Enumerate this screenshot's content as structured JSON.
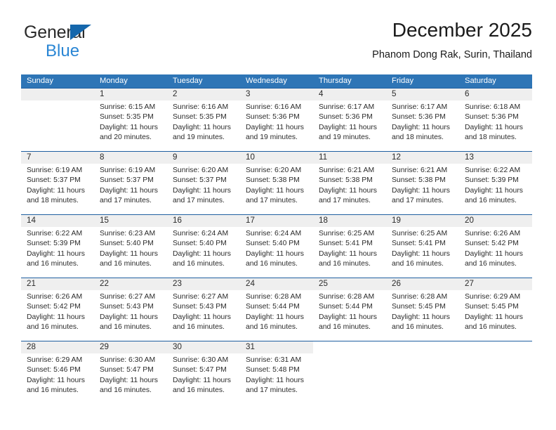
{
  "brand": {
    "name_primary": "General",
    "name_secondary": "Blue"
  },
  "header": {
    "title": "December 2025",
    "subtitle": "Phanom Dong Rak, Surin, Thailand"
  },
  "colors": {
    "header_blue": "#2e75b6",
    "row_divider": "#1f5fa0",
    "daynum_band": "#efefef",
    "logo_blue": "#2a86d4",
    "logo_triangle": "#1567ac"
  },
  "labels": {
    "sunrise_prefix": "Sunrise:",
    "sunset_prefix": "Sunset:",
    "daylight_prefix": "Daylight:"
  },
  "weekdays": [
    "Sunday",
    "Monday",
    "Tuesday",
    "Wednesday",
    "Thursday",
    "Friday",
    "Saturday"
  ],
  "weeks": [
    [
      {
        "day": "",
        "sunrise": "",
        "sunset": "",
        "daylight_line1": "",
        "daylight_line2": ""
      },
      {
        "day": "1",
        "sunrise": "Sunrise: 6:15 AM",
        "sunset": "Sunset: 5:35 PM",
        "daylight_line1": "Daylight: 11 hours",
        "daylight_line2": "and 20 minutes."
      },
      {
        "day": "2",
        "sunrise": "Sunrise: 6:16 AM",
        "sunset": "Sunset: 5:35 PM",
        "daylight_line1": "Daylight: 11 hours",
        "daylight_line2": "and 19 minutes."
      },
      {
        "day": "3",
        "sunrise": "Sunrise: 6:16 AM",
        "sunset": "Sunset: 5:36 PM",
        "daylight_line1": "Daylight: 11 hours",
        "daylight_line2": "and 19 minutes."
      },
      {
        "day": "4",
        "sunrise": "Sunrise: 6:17 AM",
        "sunset": "Sunset: 5:36 PM",
        "daylight_line1": "Daylight: 11 hours",
        "daylight_line2": "and 19 minutes."
      },
      {
        "day": "5",
        "sunrise": "Sunrise: 6:17 AM",
        "sunset": "Sunset: 5:36 PM",
        "daylight_line1": "Daylight: 11 hours",
        "daylight_line2": "and 18 minutes."
      },
      {
        "day": "6",
        "sunrise": "Sunrise: 6:18 AM",
        "sunset": "Sunset: 5:36 PM",
        "daylight_line1": "Daylight: 11 hours",
        "daylight_line2": "and 18 minutes."
      }
    ],
    [
      {
        "day": "7",
        "sunrise": "Sunrise: 6:19 AM",
        "sunset": "Sunset: 5:37 PM",
        "daylight_line1": "Daylight: 11 hours",
        "daylight_line2": "and 18 minutes."
      },
      {
        "day": "8",
        "sunrise": "Sunrise: 6:19 AM",
        "sunset": "Sunset: 5:37 PM",
        "daylight_line1": "Daylight: 11 hours",
        "daylight_line2": "and 17 minutes."
      },
      {
        "day": "9",
        "sunrise": "Sunrise: 6:20 AM",
        "sunset": "Sunset: 5:37 PM",
        "daylight_line1": "Daylight: 11 hours",
        "daylight_line2": "and 17 minutes."
      },
      {
        "day": "10",
        "sunrise": "Sunrise: 6:20 AM",
        "sunset": "Sunset: 5:38 PM",
        "daylight_line1": "Daylight: 11 hours",
        "daylight_line2": "and 17 minutes."
      },
      {
        "day": "11",
        "sunrise": "Sunrise: 6:21 AM",
        "sunset": "Sunset: 5:38 PM",
        "daylight_line1": "Daylight: 11 hours",
        "daylight_line2": "and 17 minutes."
      },
      {
        "day": "12",
        "sunrise": "Sunrise: 6:21 AM",
        "sunset": "Sunset: 5:38 PM",
        "daylight_line1": "Daylight: 11 hours",
        "daylight_line2": "and 17 minutes."
      },
      {
        "day": "13",
        "sunrise": "Sunrise: 6:22 AM",
        "sunset": "Sunset: 5:39 PM",
        "daylight_line1": "Daylight: 11 hours",
        "daylight_line2": "and 16 minutes."
      }
    ],
    [
      {
        "day": "14",
        "sunrise": "Sunrise: 6:22 AM",
        "sunset": "Sunset: 5:39 PM",
        "daylight_line1": "Daylight: 11 hours",
        "daylight_line2": "and 16 minutes."
      },
      {
        "day": "15",
        "sunrise": "Sunrise: 6:23 AM",
        "sunset": "Sunset: 5:40 PM",
        "daylight_line1": "Daylight: 11 hours",
        "daylight_line2": "and 16 minutes."
      },
      {
        "day": "16",
        "sunrise": "Sunrise: 6:24 AM",
        "sunset": "Sunset: 5:40 PM",
        "daylight_line1": "Daylight: 11 hours",
        "daylight_line2": "and 16 minutes."
      },
      {
        "day": "17",
        "sunrise": "Sunrise: 6:24 AM",
        "sunset": "Sunset: 5:40 PM",
        "daylight_line1": "Daylight: 11 hours",
        "daylight_line2": "and 16 minutes."
      },
      {
        "day": "18",
        "sunrise": "Sunrise: 6:25 AM",
        "sunset": "Sunset: 5:41 PM",
        "daylight_line1": "Daylight: 11 hours",
        "daylight_line2": "and 16 minutes."
      },
      {
        "day": "19",
        "sunrise": "Sunrise: 6:25 AM",
        "sunset": "Sunset: 5:41 PM",
        "daylight_line1": "Daylight: 11 hours",
        "daylight_line2": "and 16 minutes."
      },
      {
        "day": "20",
        "sunrise": "Sunrise: 6:26 AM",
        "sunset": "Sunset: 5:42 PM",
        "daylight_line1": "Daylight: 11 hours",
        "daylight_line2": "and 16 minutes."
      }
    ],
    [
      {
        "day": "21",
        "sunrise": "Sunrise: 6:26 AM",
        "sunset": "Sunset: 5:42 PM",
        "daylight_line1": "Daylight: 11 hours",
        "daylight_line2": "and 16 minutes."
      },
      {
        "day": "22",
        "sunrise": "Sunrise: 6:27 AM",
        "sunset": "Sunset: 5:43 PM",
        "daylight_line1": "Daylight: 11 hours",
        "daylight_line2": "and 16 minutes."
      },
      {
        "day": "23",
        "sunrise": "Sunrise: 6:27 AM",
        "sunset": "Sunset: 5:43 PM",
        "daylight_line1": "Daylight: 11 hours",
        "daylight_line2": "and 16 minutes."
      },
      {
        "day": "24",
        "sunrise": "Sunrise: 6:28 AM",
        "sunset": "Sunset: 5:44 PM",
        "daylight_line1": "Daylight: 11 hours",
        "daylight_line2": "and 16 minutes."
      },
      {
        "day": "25",
        "sunrise": "Sunrise: 6:28 AM",
        "sunset": "Sunset: 5:44 PM",
        "daylight_line1": "Daylight: 11 hours",
        "daylight_line2": "and 16 minutes."
      },
      {
        "day": "26",
        "sunrise": "Sunrise: 6:28 AM",
        "sunset": "Sunset: 5:45 PM",
        "daylight_line1": "Daylight: 11 hours",
        "daylight_line2": "and 16 minutes."
      },
      {
        "day": "27",
        "sunrise": "Sunrise: 6:29 AM",
        "sunset": "Sunset: 5:45 PM",
        "daylight_line1": "Daylight: 11 hours",
        "daylight_line2": "and 16 minutes."
      }
    ],
    [
      {
        "day": "28",
        "sunrise": "Sunrise: 6:29 AM",
        "sunset": "Sunset: 5:46 PM",
        "daylight_line1": "Daylight: 11 hours",
        "daylight_line2": "and 16 minutes."
      },
      {
        "day": "29",
        "sunrise": "Sunrise: 6:30 AM",
        "sunset": "Sunset: 5:47 PM",
        "daylight_line1": "Daylight: 11 hours",
        "daylight_line2": "and 16 minutes."
      },
      {
        "day": "30",
        "sunrise": "Sunrise: 6:30 AM",
        "sunset": "Sunset: 5:47 PM",
        "daylight_line1": "Daylight: 11 hours",
        "daylight_line2": "and 16 minutes."
      },
      {
        "day": "31",
        "sunrise": "Sunrise: 6:31 AM",
        "sunset": "Sunset: 5:48 PM",
        "daylight_line1": "Daylight: 11 hours",
        "daylight_line2": "and 17 minutes."
      },
      {
        "day": "",
        "sunrise": "",
        "sunset": "",
        "daylight_line1": "",
        "daylight_line2": ""
      },
      {
        "day": "",
        "sunrise": "",
        "sunset": "",
        "daylight_line1": "",
        "daylight_line2": ""
      },
      {
        "day": "",
        "sunrise": "",
        "sunset": "",
        "daylight_line1": "",
        "daylight_line2": ""
      }
    ]
  ]
}
